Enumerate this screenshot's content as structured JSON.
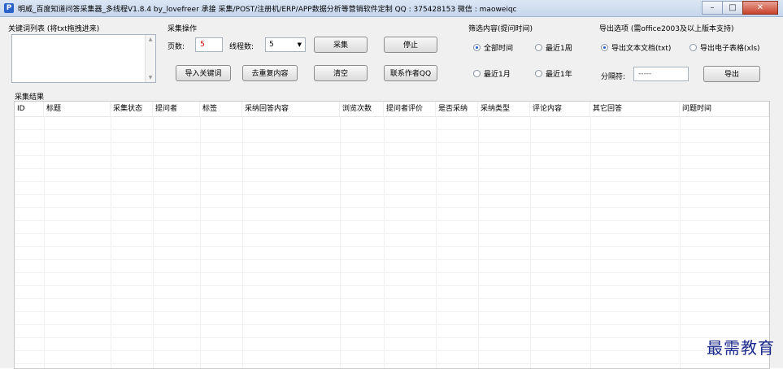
{
  "window": {
    "title": "明威_百度知道问答采集器_多线程V1.8.4 by_lovefreer  承接 采集/POST/注册机/ERP/APP数据分析等营销软件定制 QQ : 375428153  微信 : maoweiqc",
    "app_icon": "P"
  },
  "keywords": {
    "label": "关键词列表 (将txt拖拽进来)",
    "value": ""
  },
  "collect": {
    "label": "采集操作",
    "pages_label": "页数:",
    "pages_value": "5",
    "threads_label": "线程数:",
    "threads_value": "5",
    "collect_button": "采集",
    "stop_button": "停止",
    "import_button": "导入关键词",
    "dedupe_button": "去重复内容",
    "clear_button": "清空",
    "contact_button": "联系作者QQ"
  },
  "filter": {
    "label": "筛选内容(提问时间)",
    "options": [
      "全部时间",
      "最近1周",
      "最近1月",
      "最近1年"
    ],
    "selected": 0
  },
  "export": {
    "label": "导出选项 (需office2003及以上版本支持)",
    "opt_txt": "导出文本文档(txt)",
    "opt_xls": "导出电子表格(xls)",
    "selected": 0,
    "separator_label": "分隔符:",
    "separator_value": "-----",
    "export_button": "导出"
  },
  "results": {
    "label": "采集结果",
    "columns": [
      "ID",
      "标题",
      "采集状态",
      "提问者",
      "标签",
      "采纳回答内容",
      "浏览次数",
      "提问者评价",
      "是否采纳",
      "采纳类型",
      "评论内容",
      "其它回答",
      "问题时间"
    ]
  },
  "watermark": "最需教育"
}
